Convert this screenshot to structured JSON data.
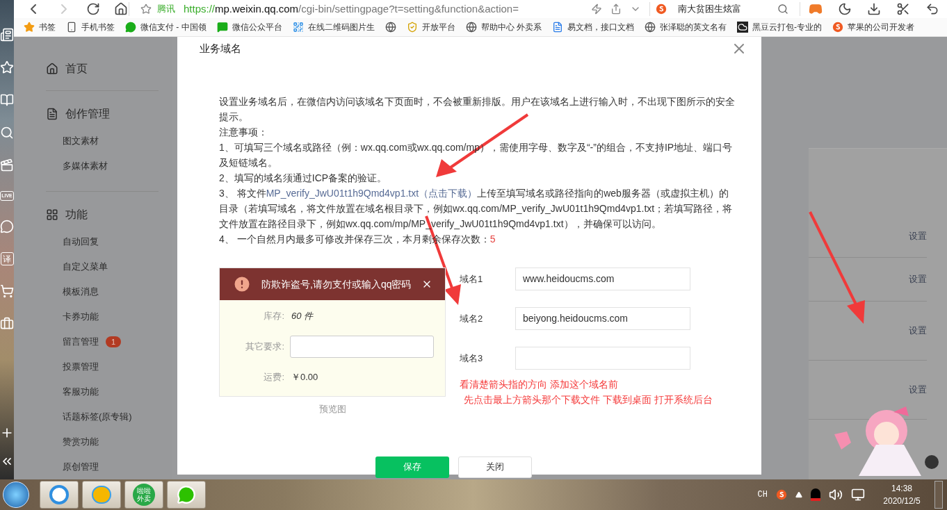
{
  "browser": {
    "forward_disabled": true,
    "address": {
      "site_label": "腾讯",
      "scheme": "https://",
      "host": "mp.weixin.qq.com",
      "path": "/cgi-bin/settingpage?t=setting&function&action="
    },
    "search": {
      "value": "南大贫困生炫富"
    }
  },
  "bookmarks": [
    {
      "kind": "star",
      "label": "书签"
    },
    {
      "kind": "phone",
      "label": "手机书签"
    },
    {
      "kind": "pay",
      "label": "微信支付 - 中国领"
    },
    {
      "kind": "chat",
      "label": "微信公众平台"
    },
    {
      "kind": "qr",
      "label": "在线二维码图片生"
    },
    {
      "kind": "globe"
    },
    {
      "kind": "shield",
      "label": "开放平台"
    },
    {
      "kind": "globe",
      "label": "帮助中心 外卖系"
    },
    {
      "kind": "doc",
      "label": "易文档，接口文档"
    },
    {
      "kind": "globe",
      "label": "张泽聪的英文名有"
    },
    {
      "kind": "cloud",
      "label": "黑豆云打包-专业的"
    },
    {
      "kind": "sogou",
      "label": "苹果的公司开发者"
    }
  ],
  "side_strip": {
    "live_label": "LIVE",
    "translate_label": "译"
  },
  "nav": {
    "home": "首页",
    "sections": [
      {
        "title": "创作管理",
        "items": [
          {
            "label": "图文素材"
          },
          {
            "label": "多媒体素材"
          }
        ]
      },
      {
        "title": "功能",
        "items": [
          {
            "label": "自动回复"
          },
          {
            "label": "自定义菜单"
          },
          {
            "label": "模板消息"
          },
          {
            "label": "卡券功能"
          },
          {
            "label": "留言管理",
            "badge": "1"
          },
          {
            "label": "投票管理"
          },
          {
            "label": "客服功能"
          },
          {
            "label": "话题标签(原专辑)"
          },
          {
            "label": "赞赏功能"
          },
          {
            "label": "原创管理"
          }
        ]
      }
    ]
  },
  "background_rows": [
    {
      "action": "设置"
    },
    {
      "action": "设置"
    },
    {
      "action": "设置"
    },
    {
      "action": "设置"
    }
  ],
  "dialog": {
    "title": "业务域名",
    "intro": "设置业务域名后，在微信内访问该域名下页面时，不会被重新排版。用户在该域名上进行输入时，不出现下图所示的安全提示。",
    "notes_heading": "注意事项：",
    "notes": [
      {
        "kind": "text",
        "text": "1、可填写三个域名或路径（例：wx.qq.com或wx.qq.com/mp），需使用字母、数字及“-”的组合，不支持IP地址、端口号及短链域名。"
      },
      {
        "kind": "text",
        "text": "2、填写的域名须通过ICP备案的验证。"
      },
      {
        "kind": "download",
        "prefix": "3、 将文件",
        "file": "MP_verify_JwU01t1h9Qmd4vp1.txt",
        "link": "（点击下载）",
        "suffix": "上传至填写域名或路径指向的web服务器（或虚拟主机）的目录（若填写域名，将文件放置在域名根目录下，例如wx.qq.com/MP_verify_JwU01t1h9Qmd4vp1.txt；若填写路径，将文件放置在路径目录下，例如wx.qq.com/mp/MP_verify_JwU01t1h9Qmd4vp1.txt），并确保可以访问。"
      },
      {
        "kind": "count",
        "text": "4、 一个自然月内最多可修改并保存三次，本月剩余保存次数：",
        "count": "5"
      }
    ],
    "preview": {
      "toast": "防欺诈盗号,请勿支付或输入qq密码",
      "rows": [
        {
          "kind": "value",
          "label": "库存:",
          "value": "60 件"
        },
        {
          "kind": "input",
          "label": "其它要求:"
        },
        {
          "kind": "value",
          "label": "运费:",
          "value": "￥0.00"
        }
      ],
      "caption": "预览图"
    },
    "domains": [
      {
        "label": "域名1",
        "value": "www.heidoucms.com"
      },
      {
        "label": "域名2",
        "value": "beiyong.heidoucms.com"
      },
      {
        "label": "域名3"
      }
    ],
    "annotation": [
      "看清楚箭头指的方向 添加这个域名前",
      "先点击最上方箭头那个下载文件 下载到桌面 打开系统后台"
    ],
    "buttons": [
      {
        "kind": "primary",
        "label": "保存"
      },
      {
        "kind": "default",
        "label": "关闭"
      }
    ]
  },
  "taskbar": {
    "apps": [
      {
        "kind": "browser"
      },
      {
        "kind": "chat"
      },
      {
        "kind": "delivery",
        "label_lines": [
          "啦啦",
          "外卖"
        ]
      },
      {
        "kind": "wechat"
      }
    ],
    "tray": {
      "ime": "CH",
      "time": "14:38",
      "date": "2020/12/5"
    }
  }
}
